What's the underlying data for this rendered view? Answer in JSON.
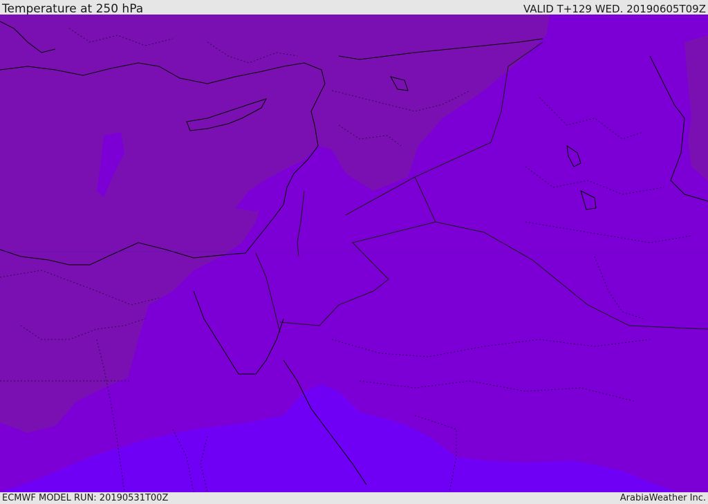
{
  "header": {
    "title": "Temperature at 250 hPa",
    "valid": "VALID T+129 WED. 20190605T09Z"
  },
  "footer": {
    "model_run": "ECMWF MODEL RUN: 20190531T00Z",
    "credit": "ArabiaWeather Inc."
  },
  "map": {
    "colors": {
      "band_coldest": "#7b10b2",
      "band_mid": "#7c00d6",
      "band_warm": "#7000f5",
      "coastline": "#000000",
      "border": "#1a1a1a"
    }
  }
}
